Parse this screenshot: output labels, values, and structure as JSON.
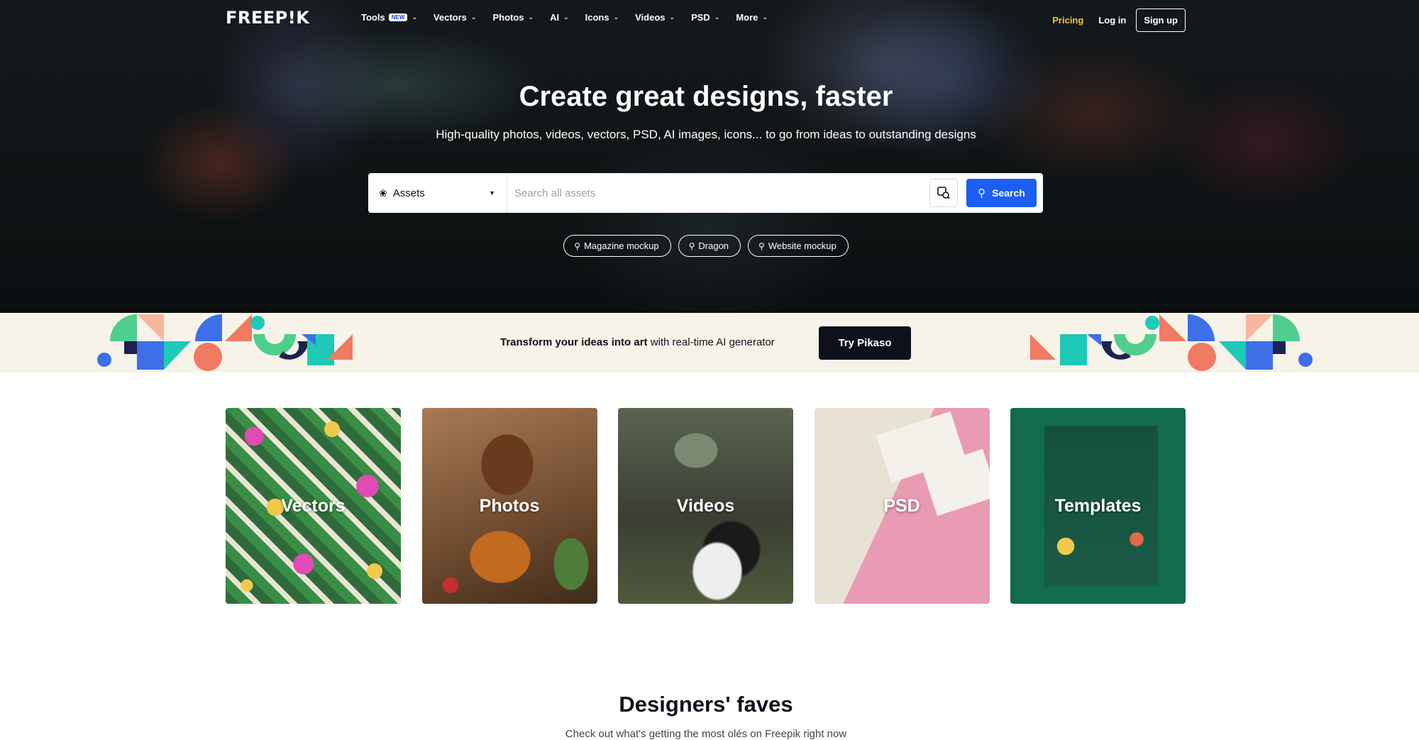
{
  "nav": {
    "logo": "FREEP!K",
    "menu": [
      {
        "label": "Tools",
        "badge": "NEW"
      },
      {
        "label": "Vectors"
      },
      {
        "label": "Photos"
      },
      {
        "label": "AI"
      },
      {
        "label": "Icons"
      },
      {
        "label": "Videos"
      },
      {
        "label": "PSD"
      },
      {
        "label": "More"
      }
    ],
    "pricing": "Pricing",
    "login": "Log in",
    "signup": "Sign up"
  },
  "hero": {
    "title": "Create great designs, faster",
    "subtitle": "High-quality photos, videos, vectors, PSD, AI images, icons... to go from ideas to outstanding designs"
  },
  "search": {
    "category": "Assets",
    "placeholder": "Search all assets",
    "button": "Search",
    "suggestions": [
      "Magazine mockup",
      "Dragon",
      "Website mockup"
    ]
  },
  "banner": {
    "bold": "Transform your ideas into art",
    "rest": " with real-time AI generator",
    "button": "Try Pikaso"
  },
  "categories": [
    "Vectors",
    "Photos",
    "Videos",
    "PSD",
    "Templates"
  ],
  "faves": {
    "title": "Designers' faves",
    "subtitle": "Check out what's getting the most olés on Freepik right now"
  },
  "colors": {
    "accent": "#1c5ef2",
    "pricing": "#f5c33b",
    "banner_bg": "#f7f3e8",
    "dark": "#0e111b"
  },
  "icons": {
    "search": "search-icon",
    "image_search": "image-search-icon",
    "assets": "assets-icon",
    "chevron": "chevron-down-icon"
  }
}
